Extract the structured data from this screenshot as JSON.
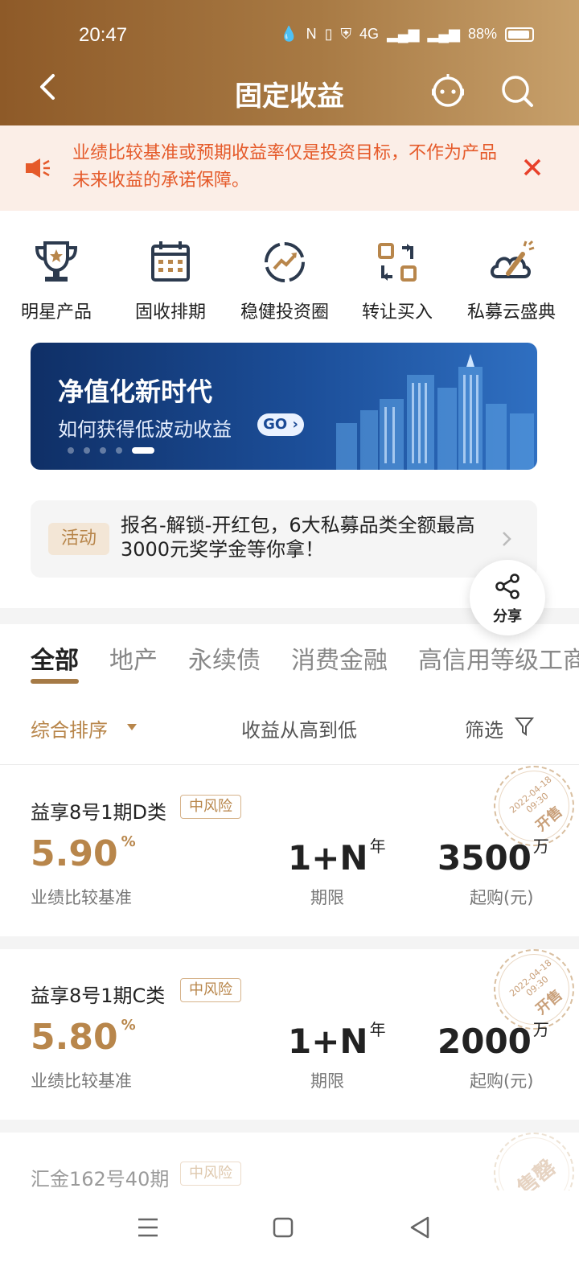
{
  "status_bar": {
    "time": "20:47",
    "network": "4G",
    "battery": "88%"
  },
  "nav": {
    "title": "固定收益",
    "back_icon": "chevron-left-icon",
    "robot_icon": "robot-icon",
    "search_icon": "search-icon"
  },
  "notice": {
    "text": "业绩比较基准或预期收益率仅是投资目标，不作为产品未来收益的承诺保障。",
    "color": "#e55a2a"
  },
  "quick_entries": [
    {
      "label": "明星产品",
      "icon": "trophy-icon"
    },
    {
      "label": "固收排期",
      "icon": "calendar-icon"
    },
    {
      "label": "稳健投资圈",
      "icon": "trend-circle-icon"
    },
    {
      "label": "转让买入",
      "icon": "transfer-icon"
    },
    {
      "label": "私募云盛典",
      "icon": "cloud-celebration-icon"
    }
  ],
  "banner": {
    "title": "净值化新时代",
    "subtitle": "如何获得低波动收益",
    "go_label": "GO ›",
    "pages": 5,
    "active_page": 5
  },
  "activity": {
    "tag": "活动",
    "text": "报名-解锁-开红包，6大私募品类全额最高3000元奖学金等你拿！"
  },
  "share": {
    "label": "分享"
  },
  "tabs": [
    "全部",
    "地产",
    "永续债",
    "消费金融",
    "高信用等级工商"
  ],
  "active_tab": "全部",
  "sort": {
    "primary": "综合排序",
    "secondary": "收益从高到低",
    "filter": "筛选"
  },
  "products": [
    {
      "name": "益享8号1期D类",
      "risk": "中风险",
      "rate": "5.90",
      "rate_unit": "%",
      "rate_label": "业绩比较基准",
      "term": "1+N",
      "term_unit": "年",
      "term_label": "期限",
      "min": "3500",
      "min_unit": "万",
      "min_label": "起购(元)",
      "stamp_date": "2022-04-18 09:30",
      "stamp_word": "开售"
    },
    {
      "name": "益享8号1期C类",
      "risk": "中风险",
      "rate": "5.80",
      "rate_unit": "%",
      "rate_label": "业绩比较基准",
      "term": "1+N",
      "term_unit": "年",
      "term_label": "期限",
      "min": "2000",
      "min_unit": "万",
      "min_label": "起购(元)",
      "stamp_date": "2022-04-18 09:30",
      "stamp_word": "开售"
    },
    {
      "name": "汇金162号40期",
      "risk": "中风险",
      "stamp_word": "售罄"
    }
  ],
  "colors": {
    "accent": "#b8864b",
    "header_start": "#8e5a28",
    "header_end": "#c7a06b",
    "notice_bg": "#fbeee7"
  }
}
